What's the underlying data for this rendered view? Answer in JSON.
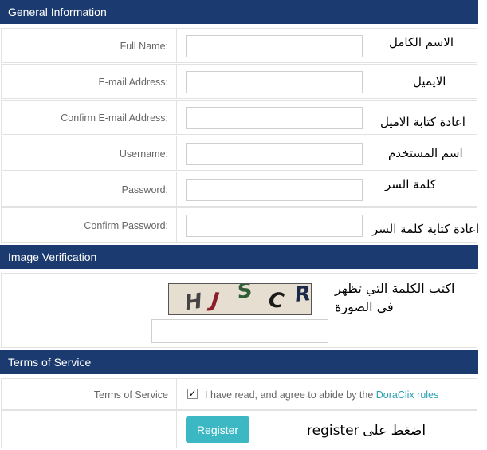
{
  "sections": {
    "general": "General Information",
    "verification": "Image Verification",
    "terms": "Terms of Service"
  },
  "fields": [
    {
      "label": "Full Name:",
      "hint": "الاسم الكامل"
    },
    {
      "label": "E-mail Address:",
      "hint": "الايميل"
    },
    {
      "label": "Confirm E-mail Address:",
      "hint": "اعادة كتابة الاميل"
    },
    {
      "label": "Username:",
      "hint": "اسم المستخدم"
    },
    {
      "label": "Password:",
      "hint": "كلمة السر"
    },
    {
      "label": "Confirm Password:",
      "hint": "اعادة كتابة كلمة السر"
    }
  ],
  "captcha": {
    "letters": [
      "H",
      "J",
      "S",
      "C",
      "R"
    ],
    "hint_line1": "اكتب الكلمة التي تظهر",
    "hint_line2": "في الصورة"
  },
  "terms": {
    "label": "Terms of Service",
    "agree_text": "I have read, and agree to abide by the",
    "link_text": "DoraClix rules"
  },
  "register": {
    "button_label": "Register",
    "hint_ar": "اضغط على",
    "hint_en": "register"
  },
  "colors": {
    "header_bg": "#1b3a6f",
    "button_bg": "#3bb8c3",
    "link": "#2a9fb4"
  }
}
